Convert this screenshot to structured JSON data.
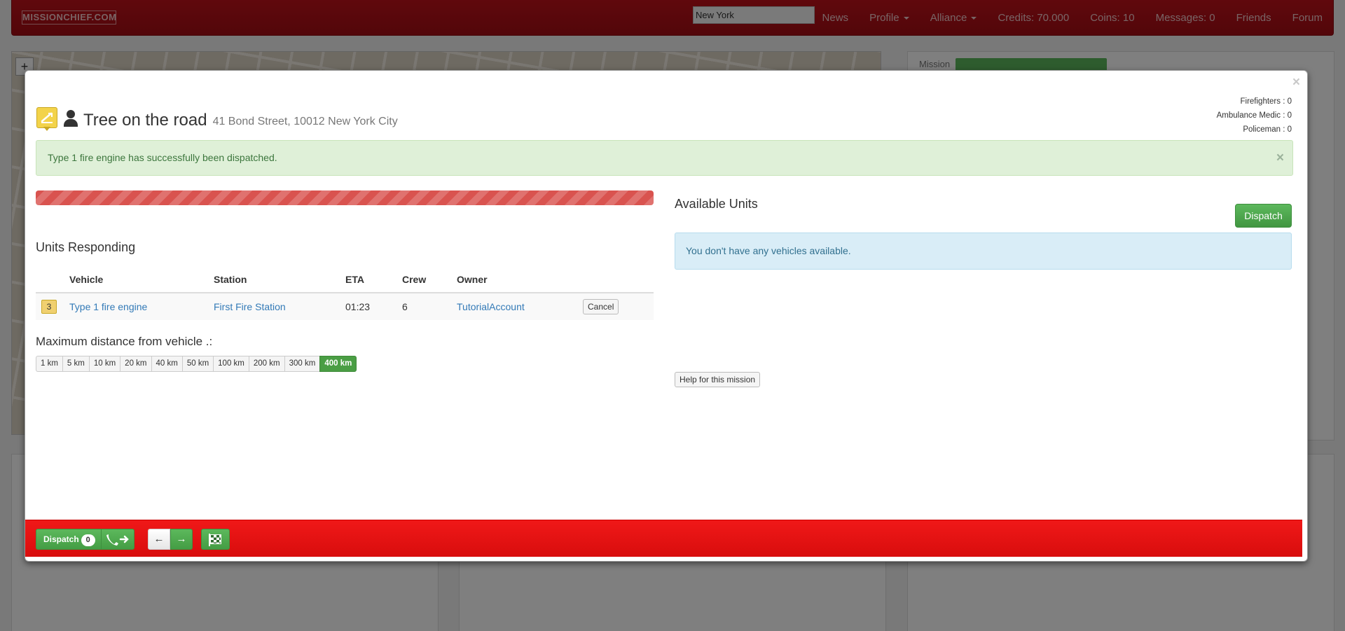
{
  "navbar": {
    "brand": "MISSIONCHIEF.COM",
    "search_value": "New York",
    "links": [
      {
        "label": "News",
        "dropdown": false
      },
      {
        "label": "Profile",
        "dropdown": true
      },
      {
        "label": "Alliance",
        "dropdown": true
      },
      {
        "label": "Credits: 70.000",
        "dropdown": false
      },
      {
        "label": "Coins: 10",
        "dropdown": false
      },
      {
        "label": "Messages: 0",
        "dropdown": false
      },
      {
        "label": "Friends",
        "dropdown": false
      },
      {
        "label": "Forum",
        "dropdown": false
      }
    ]
  },
  "background": {
    "map_zoom_label": "+",
    "panel_tab": "Mission"
  },
  "modal": {
    "close_symbol": "×",
    "crew": [
      "Firefighters : 0",
      "Ambulance Medic : 0",
      "Policeman : 0"
    ],
    "mission_title": "Tree on the road",
    "mission_address": "41 Bond Street, 10012 New York City",
    "success_message": "Type 1 fire engine has successfully been dispatched.",
    "progress_percent": 100,
    "units_responding_title": "Units Responding",
    "table": {
      "headers": [
        "",
        "Vehicle",
        "Station",
        "ETA",
        "Crew",
        "Owner",
        ""
      ],
      "rows": [
        {
          "badge": "3",
          "vehicle": "Type 1 fire engine",
          "station": "First Fire Station",
          "eta": "01:23",
          "crew": "6",
          "owner": "TutorialAccount",
          "action": "Cancel"
        }
      ]
    },
    "distance_title": "Maximum distance from vehicle .:",
    "distance_options": [
      "1 km",
      "5 km",
      "10 km",
      "20 km",
      "40 km",
      "50 km",
      "100 km",
      "200 km",
      "300 km",
      "400 km"
    ],
    "distance_selected": "400 km",
    "available_units_title": "Available Units",
    "dispatch_label": "Dispatch",
    "no_vehicles_message": "You don't have any vehicles available.",
    "help_label": "Help for this mission",
    "footer": {
      "dispatch_label": "Dispatch",
      "dispatch_count": "0",
      "prev_symbol": "←",
      "next_symbol": "→"
    }
  },
  "colors": {
    "navbar": "#b30f17",
    "success_bg": "#dff0d8",
    "info_bg": "#d9edf7",
    "progress": "#d9534f",
    "footer_bar": "#e81212",
    "button_green": "#5cb85c",
    "mission_marker": "#f3d34a"
  },
  "icons": {
    "mission": "tree-mission-marker-icon",
    "person": "person-icon",
    "call": "phone-arrow-icon",
    "finish": "checkered-flag-icon"
  }
}
